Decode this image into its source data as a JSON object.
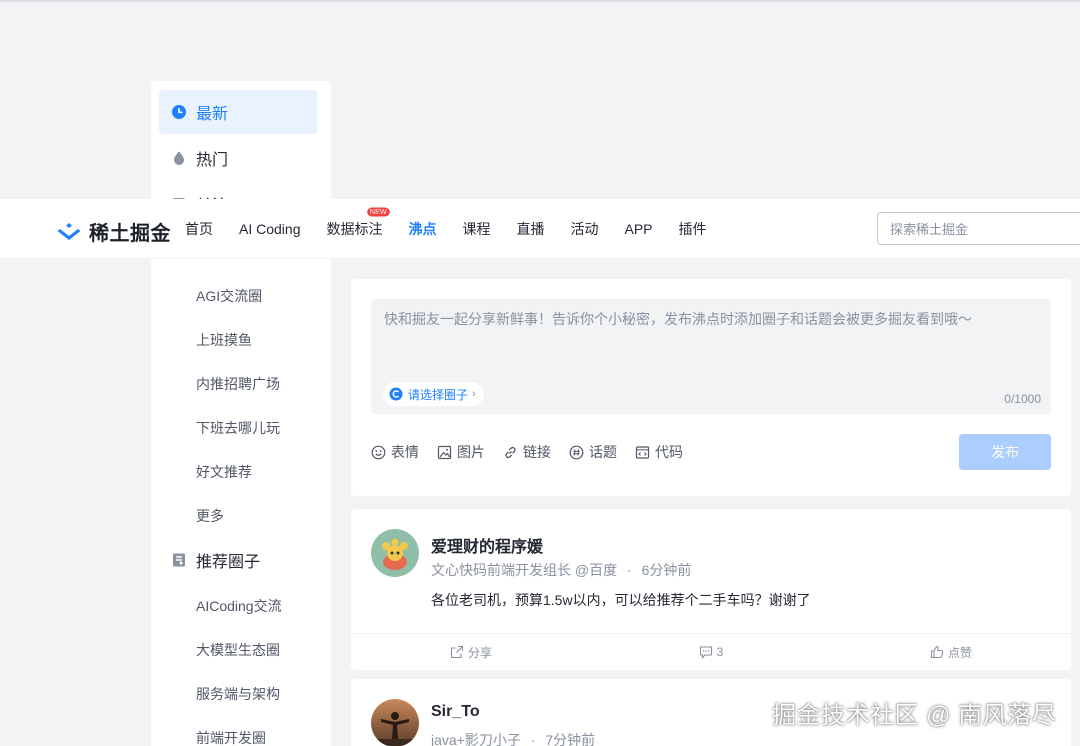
{
  "sidebar": {
    "items": [
      {
        "label": "最新",
        "icon": "clock-icon",
        "active": true
      },
      {
        "label": "热门",
        "icon": "fire-icon",
        "active": false
      },
      {
        "label": "关注",
        "icon": "follow-icon",
        "active": false
      }
    ],
    "sub_items_1": [
      "AGI交流圈",
      "上班摸鱼",
      "内推招聘广场",
      "下班去哪儿玩",
      "好文推荐",
      "更多"
    ],
    "section_title": "推荐圈子",
    "section_icon": "circle-icon",
    "sub_items_2": [
      "AICoding交流",
      "大模型生态圈",
      "服务端与架构",
      "前端开发圈"
    ]
  },
  "header": {
    "logo_text": "稀土掘金",
    "nav": [
      {
        "label": "首页"
      },
      {
        "label": "AI Coding"
      },
      {
        "label": "数据标注",
        "badge": "NEW"
      },
      {
        "label": "沸点",
        "active": true
      },
      {
        "label": "课程"
      },
      {
        "label": "直播"
      },
      {
        "label": "活动"
      },
      {
        "label": "APP"
      },
      {
        "label": "插件"
      }
    ],
    "search_placeholder": "探索稀土掘金"
  },
  "composer": {
    "placeholder": "快和掘友一起分享新鲜事！告诉你个小秘密，发布沸点时添加圈子和话题会被更多掘友看到哦～",
    "circle_select": "请选择圈子",
    "counter": "0/1000",
    "tools": [
      "表情",
      "图片",
      "链接",
      "话题",
      "代码"
    ],
    "publish": "发布"
  },
  "posts": [
    {
      "author": "爱理财的程序媛",
      "title": "文心快码前端开发组长 @百度",
      "time": "6分钟前",
      "content": "各位老司机，预算1.5w以内，可以给推荐个二手车吗？谢谢了",
      "share": "分享",
      "comments": "3",
      "like": "点赞"
    },
    {
      "author": "Sir_To",
      "title": "java+影刀小子",
      "time": "7分钟前"
    }
  ],
  "watermark": "掘金技术社区 @ 南风落尽",
  "colors": {
    "accent": "#1e80ff",
    "publish_disabled": "#abcdff",
    "background": "#f2f3f5"
  }
}
